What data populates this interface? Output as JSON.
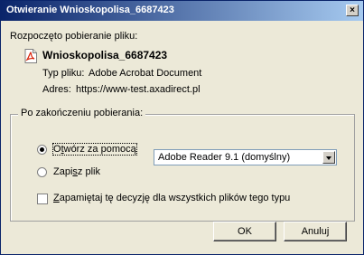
{
  "window": {
    "title": "Otwieranie Wnioskopolisa_6687423",
    "close_label": "×"
  },
  "intro": "Rozpoczęto pobieranie pliku:",
  "file": {
    "name": "Wnioskopolisa_6687423",
    "type_label": "Typ pliku:",
    "type_value": "Adobe Acrobat Document",
    "address_label": "Adres:",
    "address_value": "https://www-test.axadirect.pl"
  },
  "after_download": {
    "legend": "Po zakończeniu pobierania:",
    "open_with_label_pre": "O",
    "open_with_label_acc": "t",
    "open_with_label_post": "wórz za pomocą",
    "app_selected": "Adobe Reader 9.1 (domyślny)",
    "save_label_pre": "Zapi",
    "save_label_acc": "s",
    "save_label_post": "z plik",
    "remember_label_pre": "",
    "remember_label_acc": "Z",
    "remember_label_post": "apamiętaj tę decyzję dla wszystkich plików tego typu",
    "selected_option": "open"
  },
  "buttons": {
    "ok": "OK",
    "cancel": "Anuluj"
  },
  "colors": {
    "title_start": "#0a246a",
    "title_end": "#a6caf0",
    "face": "#ece9d8"
  },
  "icons": {
    "file": "pdf-file-icon",
    "close": "close-icon"
  }
}
